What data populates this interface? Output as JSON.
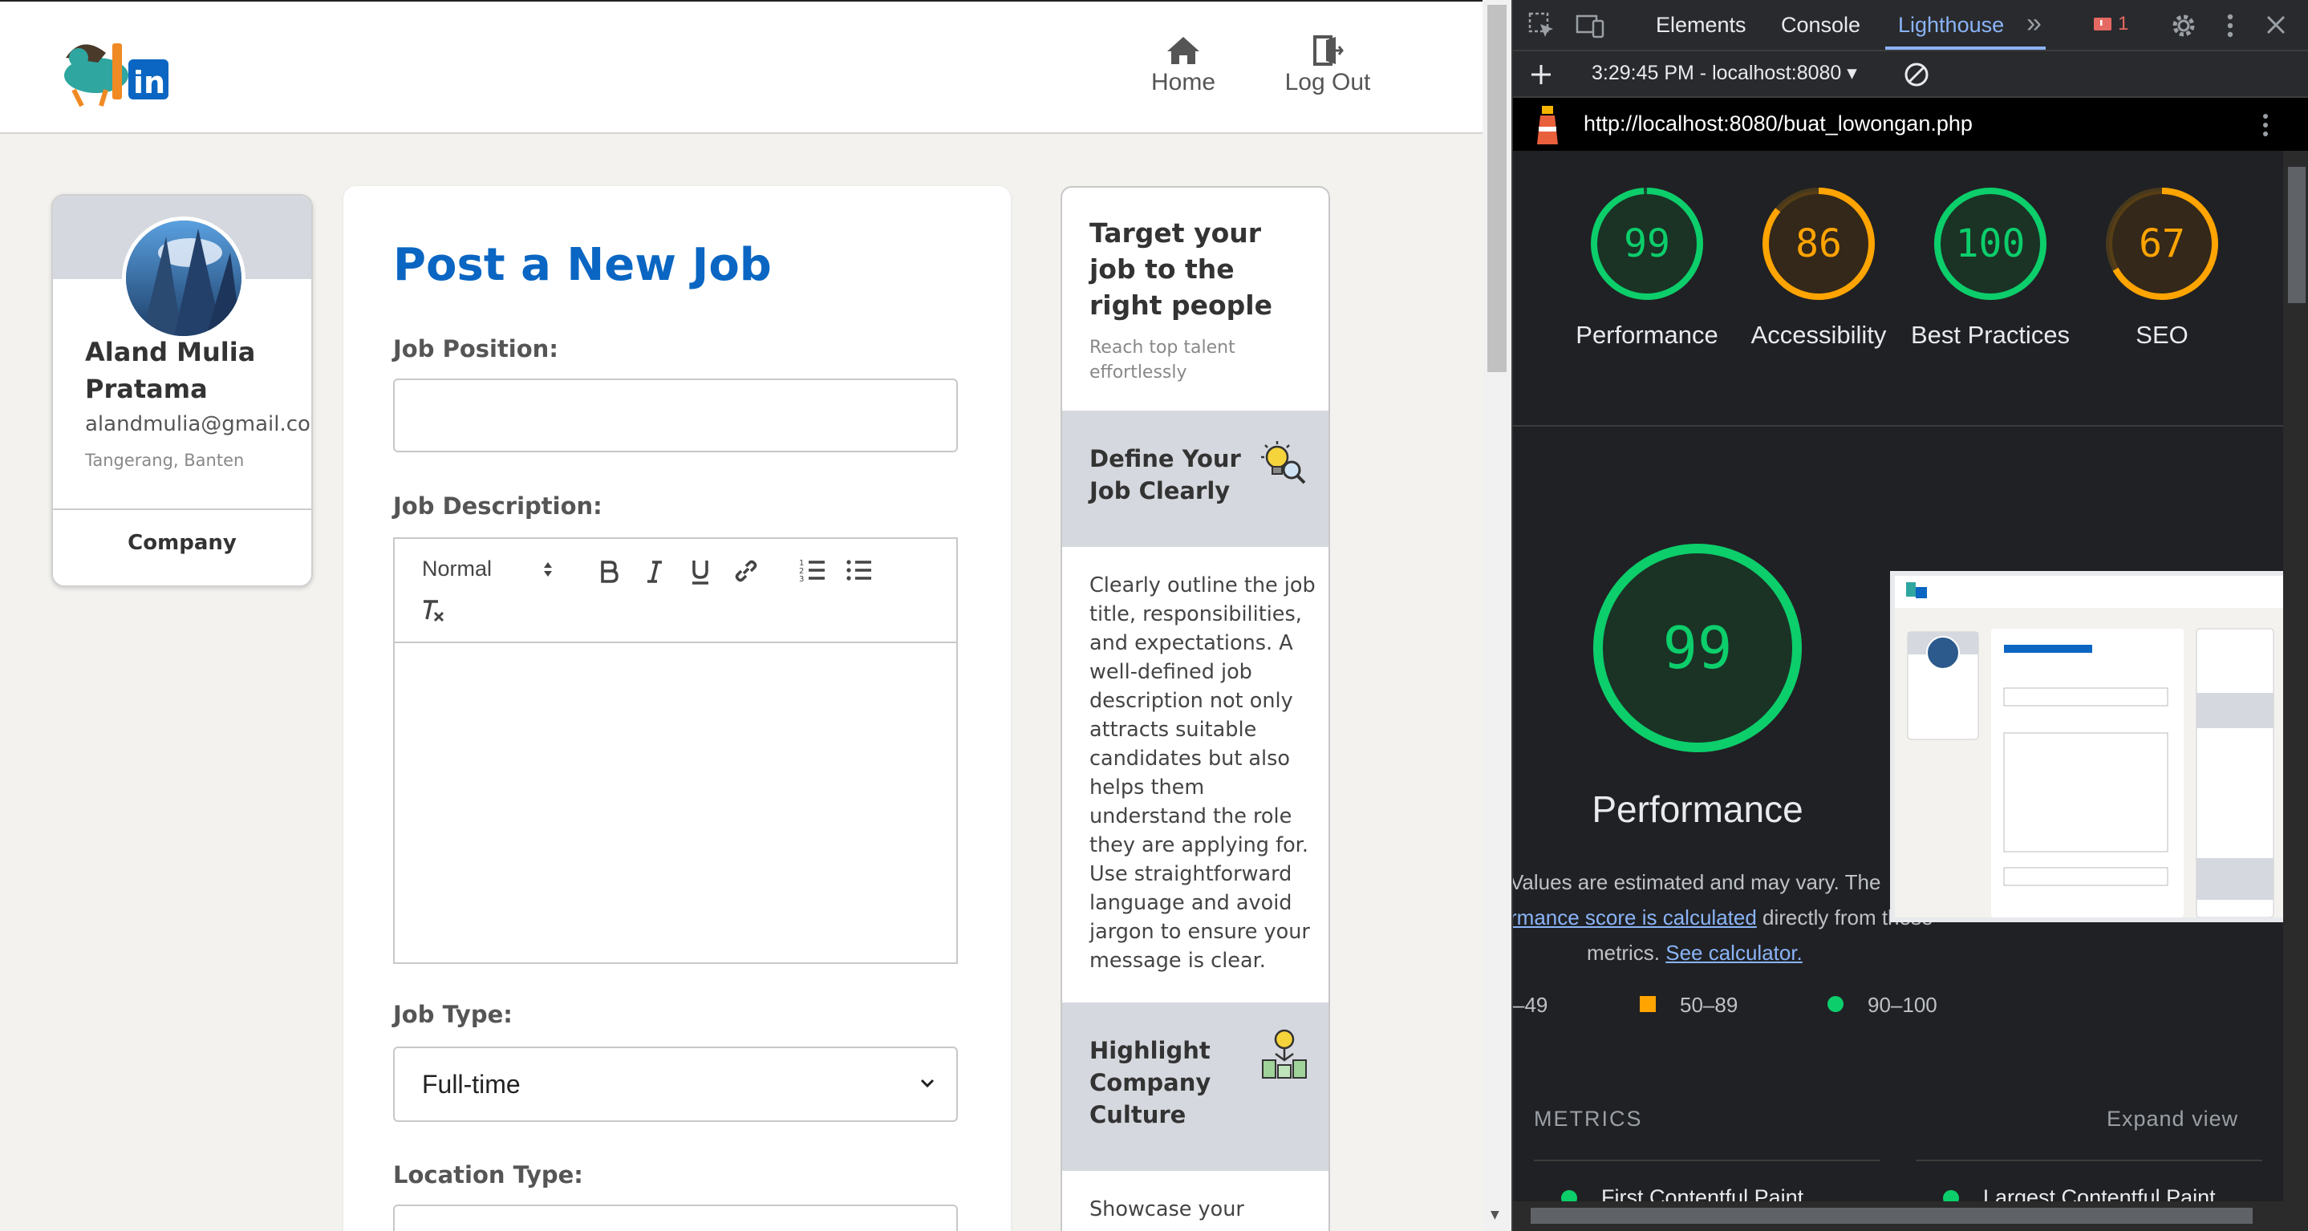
{
  "nav": {
    "home_label": "Home",
    "logout_label": "Log Out"
  },
  "profile": {
    "name": "Aland Mulia Pratama",
    "email": "alandmulia@gmail.com",
    "location": "Tangerang, Banten",
    "company_label": "Company"
  },
  "form": {
    "title": "Post a New Job",
    "job_position_label": "Job Position:",
    "job_position_value": "",
    "job_description_label": "Job Description:",
    "editor": {
      "heading_select": "Normal"
    },
    "job_type_label": "Job Type:",
    "job_type_value": "Full-time",
    "location_type_label": "Location Type:"
  },
  "tips": {
    "title": "Target your job to the right people",
    "subtitle": "Reach top talent effortlessly",
    "sections": [
      {
        "heading": "Define Your Job Clearly",
        "icon": "bulb-search-icon",
        "body": "Clearly outline the job title, responsibilities, and expectations. A well-defined job description not only attracts suitable candidates but also helps them understand the role they are applying for. Use straightforward language and avoid jargon to ensure your message is clear."
      },
      {
        "heading": "Highlight Company Culture",
        "icon": "culture-icon",
        "body": "Showcase your"
      }
    ]
  },
  "devtools": {
    "tabs": [
      "Elements",
      "Console",
      "Lighthouse"
    ],
    "active_tab": "Lighthouse",
    "issues_count": "1",
    "report_selector": "3:29:45 PM - localhost:8080",
    "url": "http://localhost:8080/buat_lowongan.php",
    "scores": [
      {
        "label": "Performance",
        "value": 99,
        "color": "#0cce6b"
      },
      {
        "label": "Accessibility",
        "value": 86,
        "color": "#ffa400"
      },
      {
        "label": "Best Practices",
        "value": 100,
        "color": "#0cce6b"
      },
      {
        "label": "SEO",
        "value": 67,
        "color": "#ffa400"
      }
    ],
    "big_score": 99,
    "big_label": "Performance",
    "note_line1": "Values are estimated and may vary. The",
    "note_link1": "rmance score is calculated",
    "note_line2": " directly from these",
    "note_line3": "metrics. ",
    "note_link2": "See calculator.",
    "legend": {
      "low": "–49",
      "mid": "50–89",
      "high": "90–100"
    },
    "metrics_heading": "METRICS",
    "expand_label": "Expand view",
    "metric_items": [
      "First Contentful Paint",
      "Largest Contentful Paint"
    ]
  }
}
